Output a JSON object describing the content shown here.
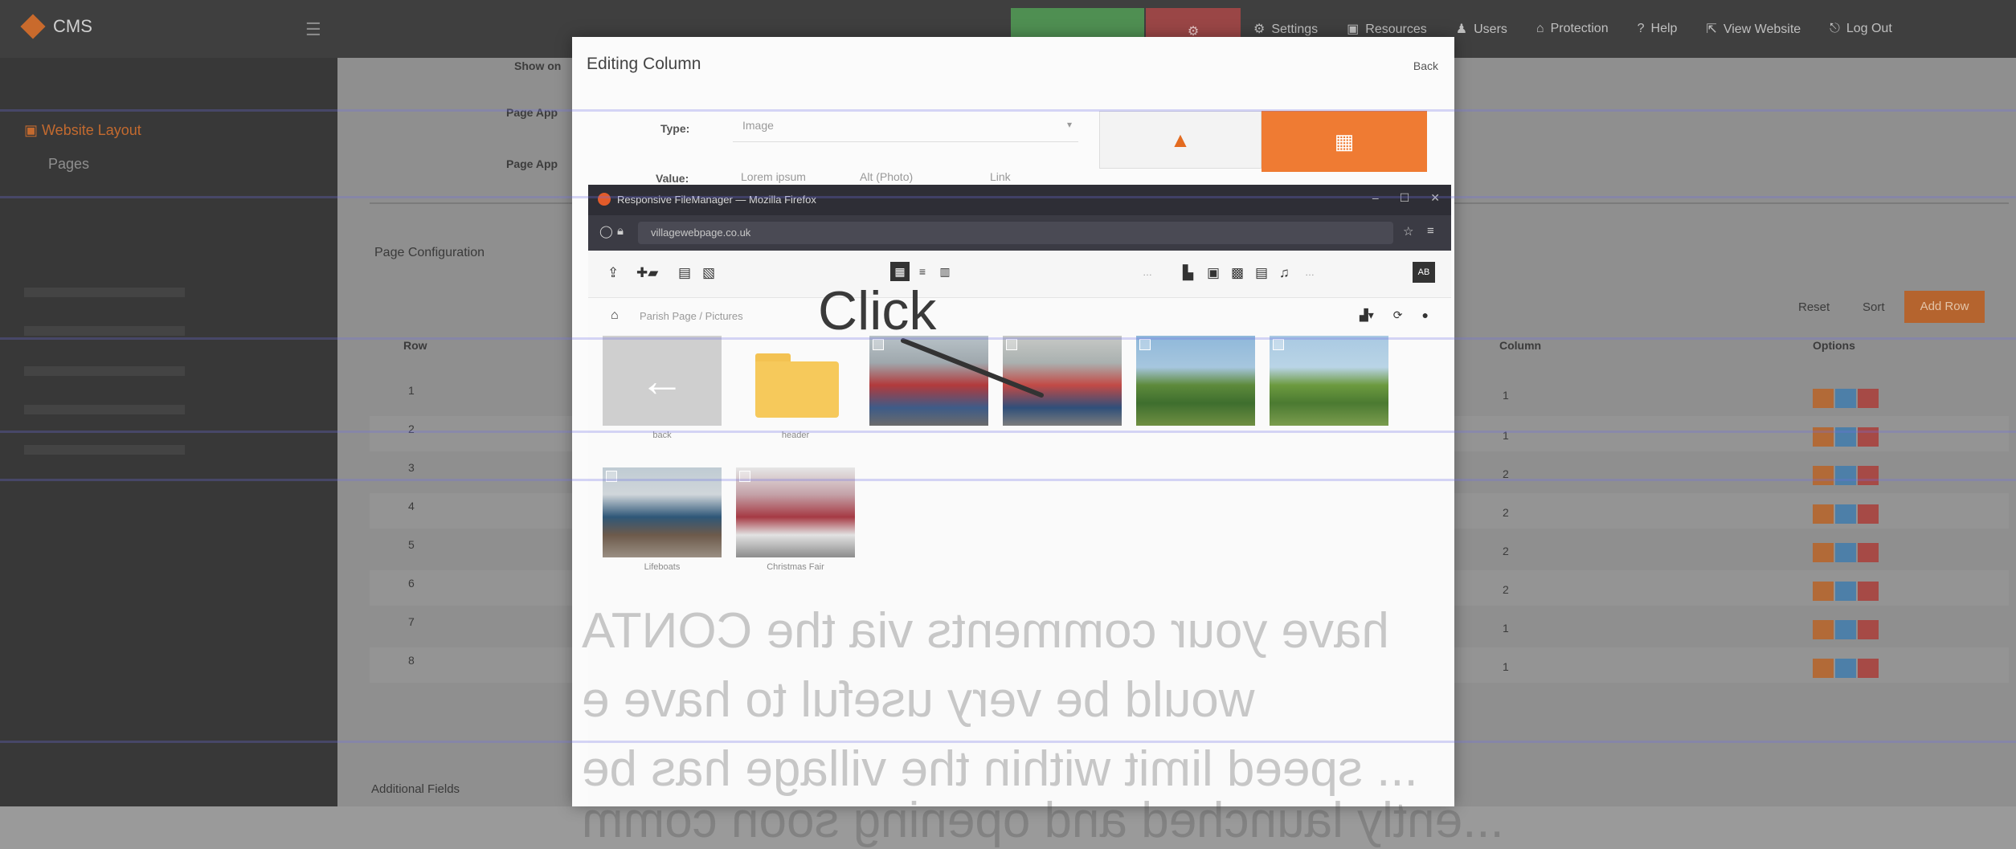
{
  "cms": {
    "brand": "CMS",
    "top_links": [
      "Settings",
      "Resources",
      "Users",
      "Protection",
      "Help",
      "View Website",
      "Log Out"
    ],
    "sidebar": {
      "active": "Website Layout",
      "sub": "Pages"
    },
    "form_labels": [
      "Show on",
      "Page App",
      "Page App"
    ],
    "page_config_title": "Page Configuration",
    "table": {
      "headers": {
        "row": "Row",
        "column": "Column",
        "options": "Options"
      },
      "rows": [
        {
          "row": "1",
          "column": "1"
        },
        {
          "row": "2",
          "column": "1"
        },
        {
          "row": "3",
          "column": "2"
        },
        {
          "row": "4",
          "column": "2"
        },
        {
          "row": "5",
          "column": "2"
        },
        {
          "row": "6",
          "column": "2"
        },
        {
          "row": "7",
          "column": "1"
        },
        {
          "row": "8",
          "column": "1"
        }
      ]
    },
    "reset": "Reset",
    "sort": "Sort",
    "add_row": "Add Row",
    "additional_fields": "Additional Fields"
  },
  "modal": {
    "title": "Editing Column",
    "back": "Back",
    "type_label": "Type:",
    "type_value": "Image",
    "value_label": "Value:",
    "value_parts": [
      "Lorem ipsum",
      "Alt (Photo)",
      "Link"
    ]
  },
  "file_manager": {
    "window_title": "Responsive FileManager — Mozilla Firefox",
    "url": "villagewebpage.co.uk",
    "language": "AB",
    "breadcrumb": "Parish Page / Pictures",
    "items": [
      {
        "kind": "back",
        "label": "back"
      },
      {
        "kind": "folder",
        "label": "header"
      },
      {
        "kind": "photo",
        "label": ""
      },
      {
        "kind": "photo",
        "label": ""
      },
      {
        "kind": "photo",
        "label": ""
      },
      {
        "kind": "photo",
        "label": ""
      },
      {
        "kind": "photo",
        "label": "Lifeboats"
      },
      {
        "kind": "photo",
        "label": "Christmas Fair"
      }
    ]
  },
  "annotation": {
    "text": "Click"
  },
  "bleed_through": [
    "have your comments via the CONTA",
    "would be very useful to have e",
    "... speed limit within the village has be",
    "...ently launched and opening soon comm"
  ],
  "colors": {
    "orange_accent": "#ef7b33",
    "top_green": "#4f8f52",
    "top_red": "#9a4646",
    "folder_yellow": "#f6c95b"
  }
}
